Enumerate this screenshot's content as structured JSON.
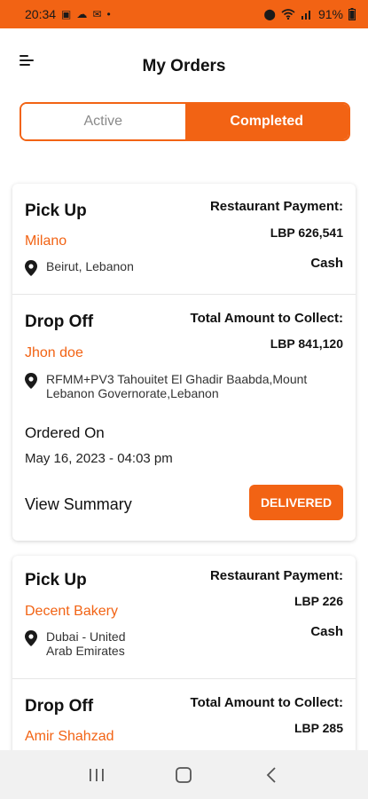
{
  "status_bar": {
    "time": "20:34",
    "left_icons": [
      "gallery-icon",
      "cloud-icon",
      "mail-icon",
      "dot-icon"
    ],
    "right_icons": [
      "location-icon",
      "wifi-icon",
      "signal-icon"
    ],
    "battery": "91%"
  },
  "header": {
    "title": "My Orders",
    "menu_icon": "menu-icon"
  },
  "tabs": {
    "active_label": "Active",
    "completed_label": "Completed",
    "selected": "Completed"
  },
  "orders": [
    {
      "pickup": {
        "title": "Pick Up",
        "name": "Milano",
        "address": "Beirut, Lebanon",
        "payment_label": "Restaurant Payment:",
        "amount": "LBP 626,541",
        "method": "Cash"
      },
      "dropoff": {
        "title": "Drop Off",
        "name": "Jhon doe",
        "address": "RFMM+PV3 Tahouitet El Ghadir Baabda,Mount Lebanon Governorate,Lebanon",
        "collect_label": "Total Amount to Collect:",
        "amount": "LBP 841,120"
      },
      "ordered_on_label": "Ordered On",
      "ordered_on": "May 16, 2023 - 04:03 pm",
      "view_summary": "View Summary",
      "status": "DELIVERED"
    },
    {
      "pickup": {
        "title": "Pick Up",
        "name": "Decent Bakery",
        "address": "Dubai - United Arab Emirates",
        "payment_label": "Restaurant Payment:",
        "amount": "LBP 226",
        "method": "Cash"
      },
      "dropoff": {
        "title": "Drop Off",
        "name": "Amir Shahzad",
        "collect_label": "Total Amount to Collect:",
        "amount": "LBP 285"
      }
    }
  ],
  "nav_bar": {
    "buttons": [
      "recent-apps-icon",
      "home-icon",
      "back-icon"
    ]
  },
  "colors": {
    "accent": "#f26314",
    "text": "#111111",
    "muted": "#8a8a8a",
    "nav_bg": "#f1f1f1"
  }
}
